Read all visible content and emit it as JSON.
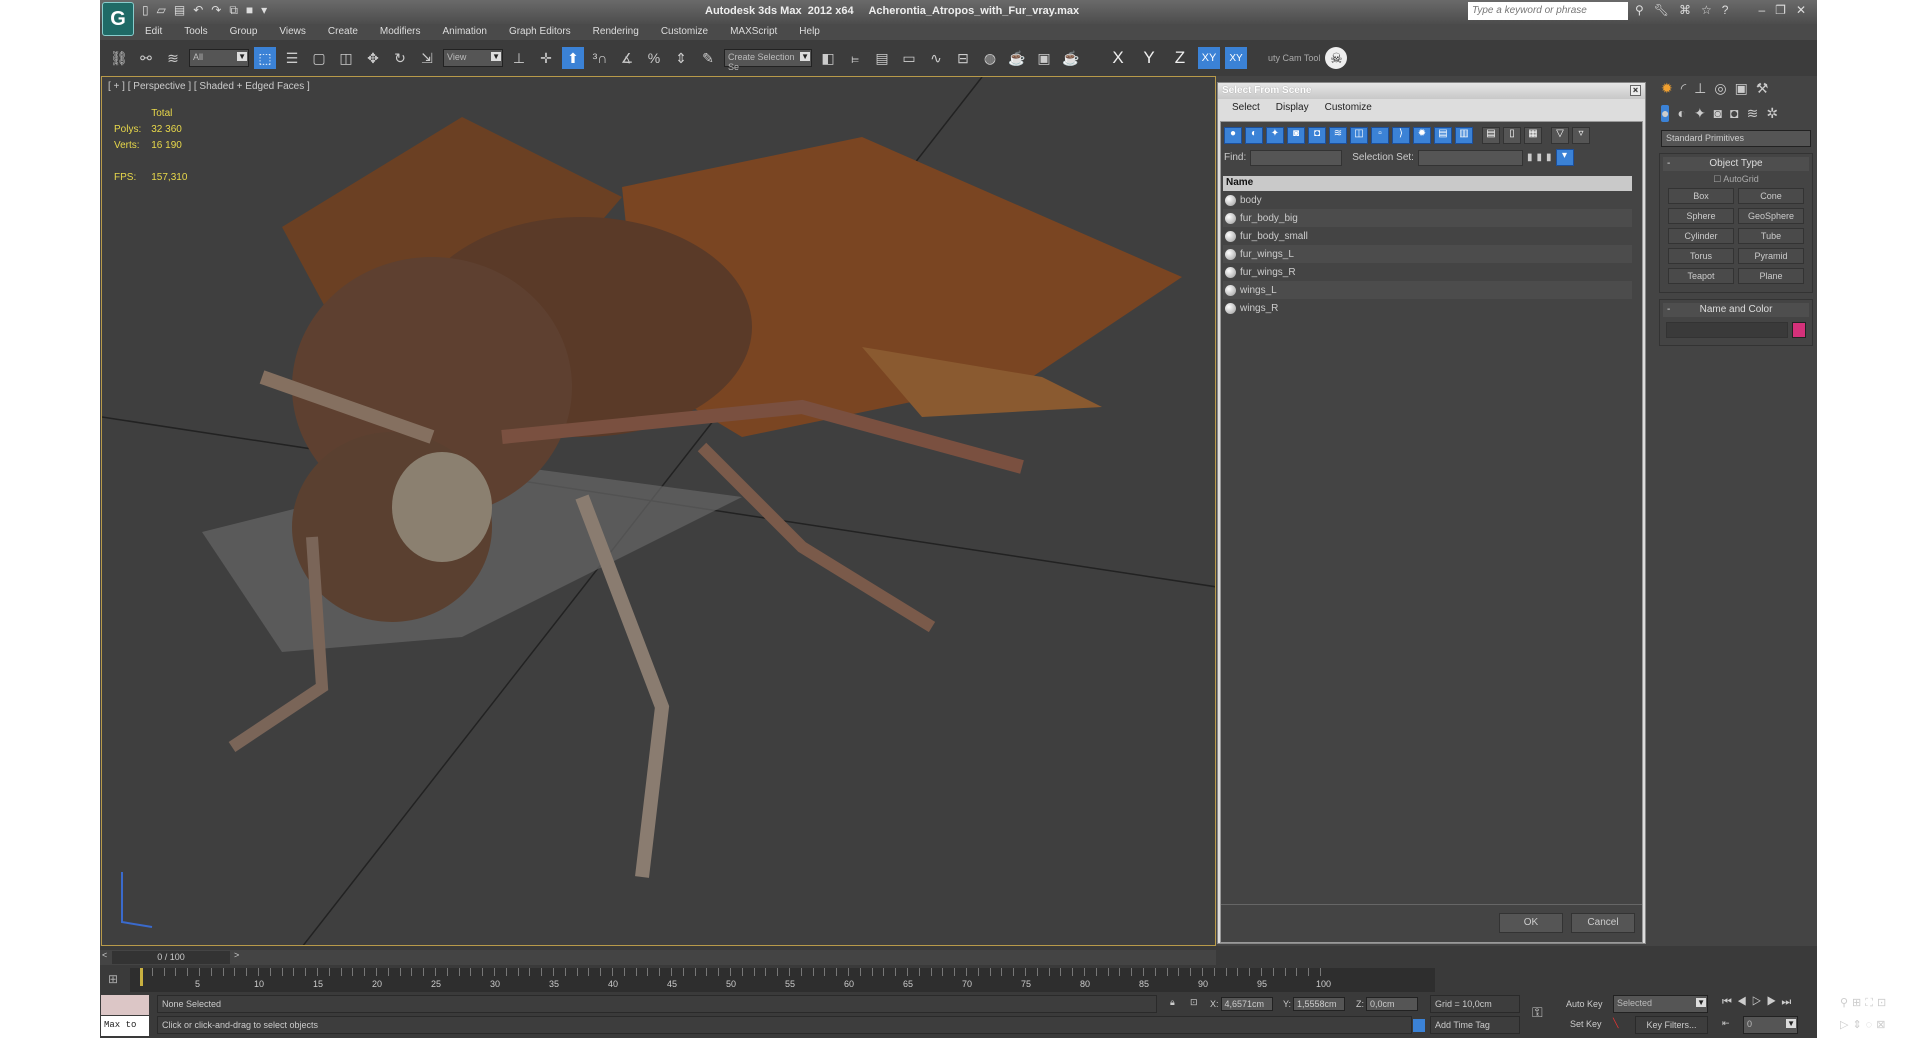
{
  "app": {
    "title": "Autodesk 3ds Max  2012 x64",
    "file": "Acherontia_Atropos_with_Fur_vray.max",
    "search_placeholder": "Type a keyword or phrase"
  },
  "menu": [
    "Edit",
    "Tools",
    "Group",
    "Views",
    "Create",
    "Modifiers",
    "Animation",
    "Graph Editors",
    "Rendering",
    "Customize",
    "MAXScript",
    "Help"
  ],
  "toolbar": {
    "filter": "All",
    "ref_coord": "View",
    "selection_set": "Create Selection Se",
    "axes": [
      "X",
      "Y",
      "Z"
    ],
    "xy": "XY",
    "cam_tool": "uty Cam Tool"
  },
  "viewport": {
    "label": "[ + ] [ Perspective ] [ Shaded + Edged Faces ]",
    "stats": {
      "header": "Total",
      "polys_label": "Polys:",
      "polys": "32 360",
      "verts_label": "Verts:",
      "verts": "16 190",
      "fps_label": "FPS:",
      "fps": "157,310"
    }
  },
  "dialog": {
    "title": "Select From Scene",
    "menu": [
      "Select",
      "Display",
      "Customize"
    ],
    "find_label": "Find:",
    "selset_label": "Selection Set:",
    "column": "Name",
    "items": [
      "body",
      "fur_body_big",
      "fur_body_small",
      "fur_wings_L",
      "fur_wings_R",
      "wings_L",
      "wings_R"
    ],
    "ok": "OK",
    "cancel": "Cancel"
  },
  "command_panel": {
    "category": "Standard Primitives",
    "object_type": "Object Type",
    "autogrid": "AutoGrid",
    "buttons": [
      "Box",
      "Cone",
      "Sphere",
      "GeoSphere",
      "Cylinder",
      "Tube",
      "Torus",
      "Pyramid",
      "Teapot",
      "Plane"
    ],
    "name_color": "Name and Color",
    "color": "#d4317a"
  },
  "timeline": {
    "position": "0 / 100",
    "ticks": [
      "5",
      "10",
      "15",
      "20",
      "25",
      "30",
      "35",
      "40",
      "45",
      "50",
      "55",
      "60",
      "65",
      "70",
      "75",
      "80",
      "85",
      "90",
      "95",
      "100"
    ]
  },
  "status": {
    "maxscript": "Max to",
    "selection": "None Selected",
    "prompt": "Click or click-and-drag to select objects",
    "x_label": "X:",
    "x": "4,6571cm",
    "y_label": "Y:",
    "y": "1,5558cm",
    "z_label": "Z:",
    "z": "0,0cm",
    "grid": "Grid = 10,0cm",
    "add_time_tag": "Add Time Tag",
    "auto_key": "Auto Key",
    "set_key": "Set Key",
    "key_mode": "Selected",
    "key_filters": "Key Filters...",
    "frame": "0"
  }
}
